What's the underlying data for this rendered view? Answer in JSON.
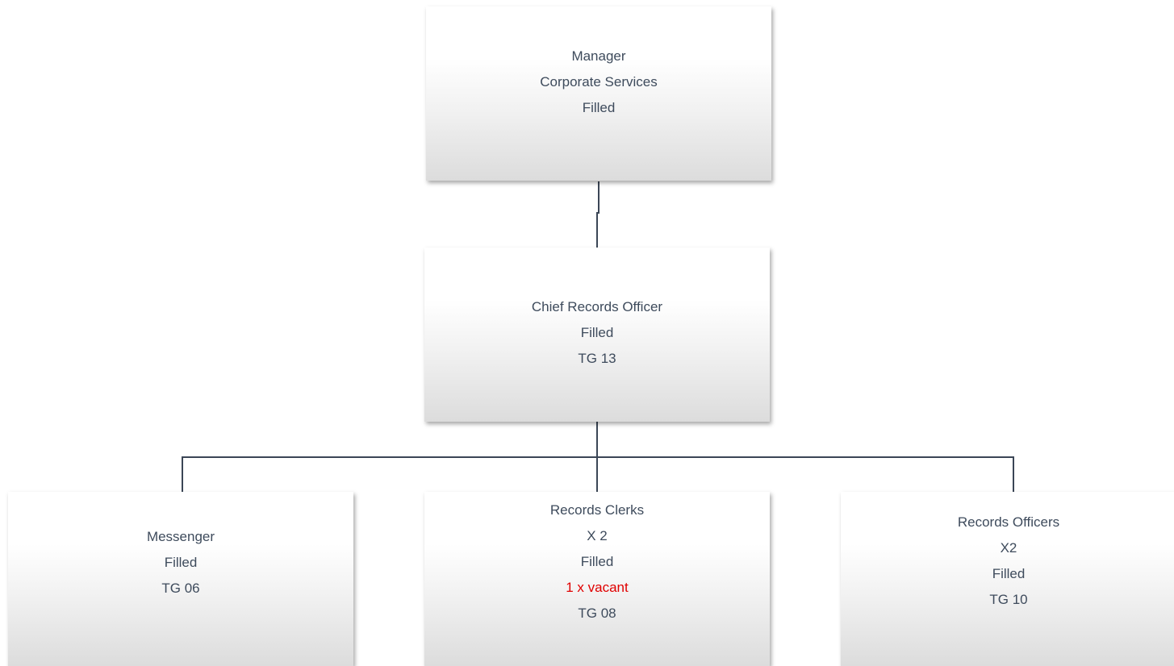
{
  "org_chart": {
    "manager": {
      "lines": [
        "Manager",
        "Corporate Services",
        "Filled"
      ]
    },
    "chief_records_officer": {
      "lines": [
        "Chief Records Officer",
        "Filled",
        "TG 13"
      ]
    },
    "messenger": {
      "lines": [
        "Messenger",
        "Filled",
        "TG 06"
      ]
    },
    "records_clerks": {
      "lines": [
        "Records Clerks",
        "X 2",
        "Filled",
        "1 x vacant",
        "TG 08"
      ]
    },
    "records_officers": {
      "lines": [
        "Records Officers",
        "X2",
        "Filled",
        "TG 10"
      ]
    },
    "colors": {
      "text": "#3e4b5c",
      "vacant": "#e00000",
      "connector": "#3b4656"
    }
  }
}
